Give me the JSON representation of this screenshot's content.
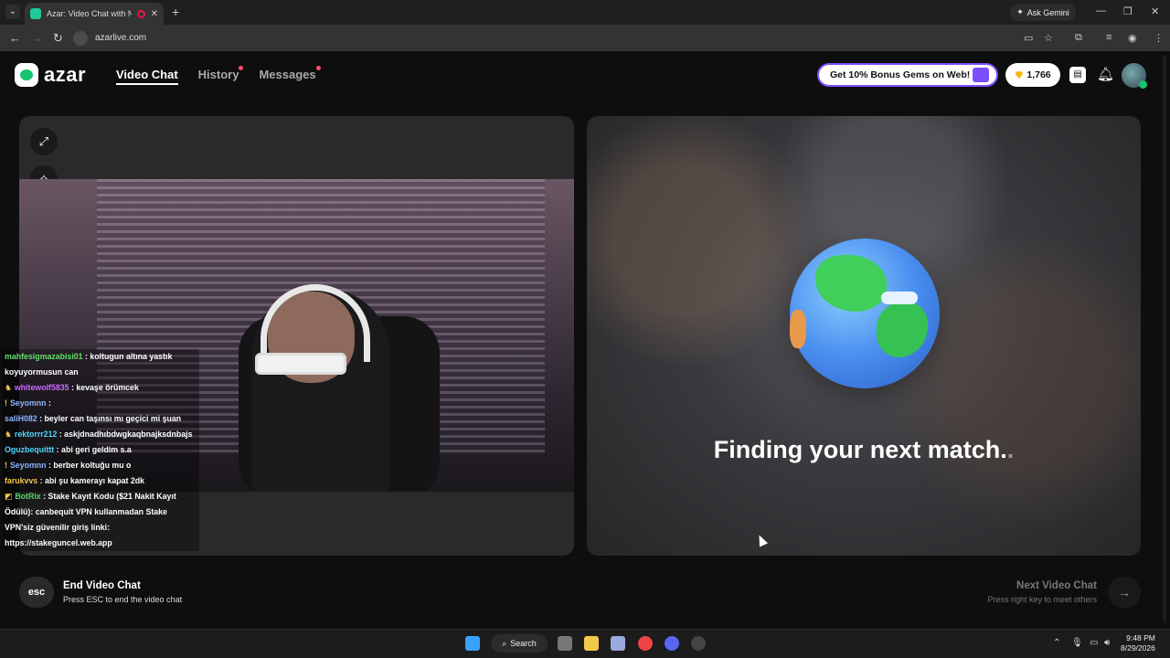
{
  "browser": {
    "tab_title": "Azar: Video Chat with New",
    "close_glyph": "✕",
    "new_tab_glyph": "+",
    "ask_gemini": "Ask Gemini",
    "url": "azarlive.com"
  },
  "header": {
    "logo_text": "azar",
    "nav": [
      {
        "label": "Video Chat",
        "active": true,
        "dot": false
      },
      {
        "label": "History",
        "active": false,
        "dot": true
      },
      {
        "label": "Messages",
        "active": false,
        "dot": true
      }
    ],
    "promo_label": "Get 10% Bonus Gems on Web!",
    "gem_count": "1,766"
  },
  "chat": [
    {
      "user": "mahfesigmazabisi01",
      "color": "#62e06a",
      "msg": " : koltugun altına yastık koyuyormusun can",
      "badge": ""
    },
    {
      "user": "whitewolf5835",
      "color": "#c86bff",
      "msg": " : kevaşe örümcek",
      "badge": "♞"
    },
    {
      "user": "Seyomnn",
      "color": "#8ab4ff",
      "msg": " : ",
      "badge": "!"
    },
    {
      "user": "saliH082",
      "color": "#8ab4ff",
      "msg": " : beyler can taşınsı mı geçici mi şuan",
      "badge": ""
    },
    {
      "user": "rektorrr212",
      "color": "#4fd6ff",
      "msg": " : askjdnadhıbdwgkaqbnajksdnbajs",
      "badge": "♞"
    },
    {
      "user": "Oguzbequittt",
      "color": "#4fd6ff",
      "msg": " : abi geri geldim s.a",
      "badge": ""
    },
    {
      "user": "Seyomnn",
      "color": "#8ab4ff",
      "msg": " : berber koltuğu mu o",
      "badge": "!"
    },
    {
      "user": "farukvvs",
      "color": "#f2c94c",
      "msg": " : abi şu kamerayı kapat 2dk",
      "badge": ""
    },
    {
      "user": "BotRix",
      "color": "#5ad46a",
      "msg": " : Stake Kayıt Kodu ($21 Nakit Kayıt Ödülü): canbequit VPN kullanmadan Stake VPN'siz güvenilir giriş linki: https://stakeguncel.web.app",
      "badge": "◩"
    }
  ],
  "match": {
    "finding_text": "Finding your next match.",
    "finding_dim": "."
  },
  "footer": {
    "esc_label": "esc",
    "end_title": "End Video Chat",
    "end_sub": "Press ESC to end the video chat",
    "next_title": "Next Video Chat",
    "next_sub": "Press right key to meet others"
  },
  "taskbar": {
    "search_label": "Search",
    "time": "9:48 PM",
    "date": "8/29/2026"
  },
  "colors": {
    "accent_purple": "#7c4dff",
    "azar_green": "#15c46e",
    "notif_dot": "#ff4d6d"
  }
}
